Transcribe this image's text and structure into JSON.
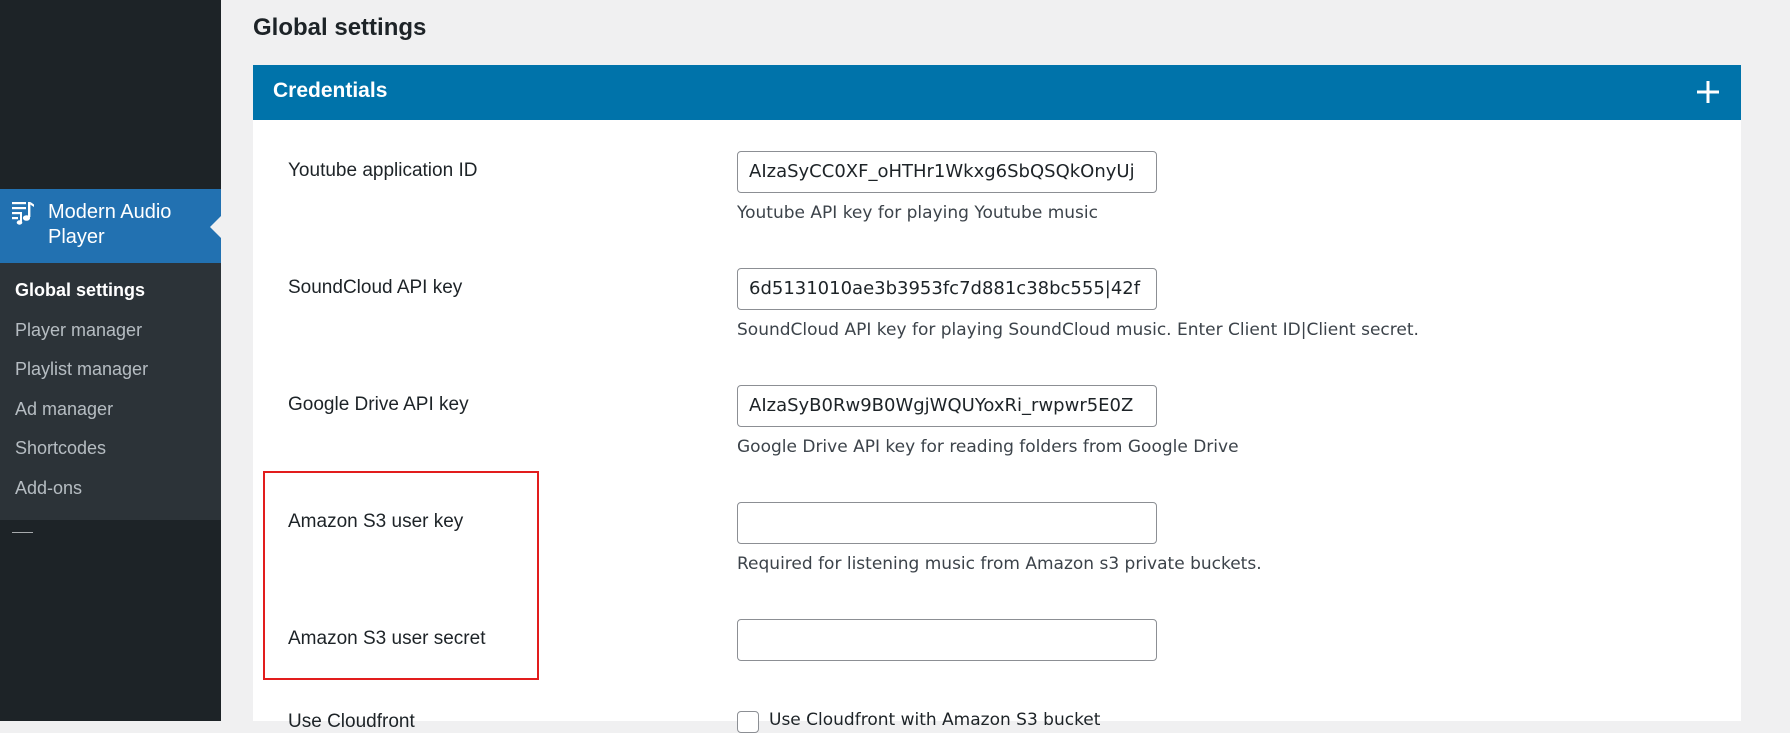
{
  "sidebar": {
    "active_menu": {
      "icon": "playlist-music-icon",
      "label": "Modern Audio Player"
    },
    "submenu": [
      {
        "label": "Global settings",
        "current": true
      },
      {
        "label": "Player manager",
        "current": false
      },
      {
        "label": "Playlist manager",
        "current": false
      },
      {
        "label": "Ad manager",
        "current": false
      },
      {
        "label": "Shortcodes",
        "current": false
      },
      {
        "label": "Add-ons",
        "current": false
      }
    ]
  },
  "page": {
    "title": "Global settings"
  },
  "panel": {
    "title": "Credentials",
    "toggle_icon": "plus-icon",
    "header_color": "#0073aa"
  },
  "fields": {
    "youtube": {
      "label": "Youtube application ID",
      "value": "AIzaSyCC0XF_oHTHr1Wkxg6SbQSQkOnyUj",
      "description": "Youtube API key for playing Youtube music"
    },
    "soundcloud": {
      "label": "SoundCloud API key",
      "value": "6d5131010ae3b3953fc7d881c38bc555|42f",
      "description": "SoundCloud API key for playing SoundCloud music. Enter Client ID|Client secret."
    },
    "gdrive": {
      "label": "Google Drive API key",
      "value": "AIzaSyB0Rw9B0WgjWQUYoxRi_rwpwr5E0Z",
      "description": "Google Drive API key for reading folders from Google Drive"
    },
    "s3_key": {
      "label": "Amazon S3 user key",
      "value": "",
      "description": "Required for listening music from Amazon s3 private buckets."
    },
    "s3_secret": {
      "label": "Amazon S3 user secret",
      "value": ""
    },
    "cloudfront": {
      "label": "Use Cloudfront",
      "checkbox_label": "Use Cloudfront with Amazon S3 bucket",
      "checked": false
    }
  },
  "colors": {
    "sidebar_bg": "#1d2327",
    "active_menu_bg": "#2271b1",
    "highlight_border": "#e21d1d"
  }
}
